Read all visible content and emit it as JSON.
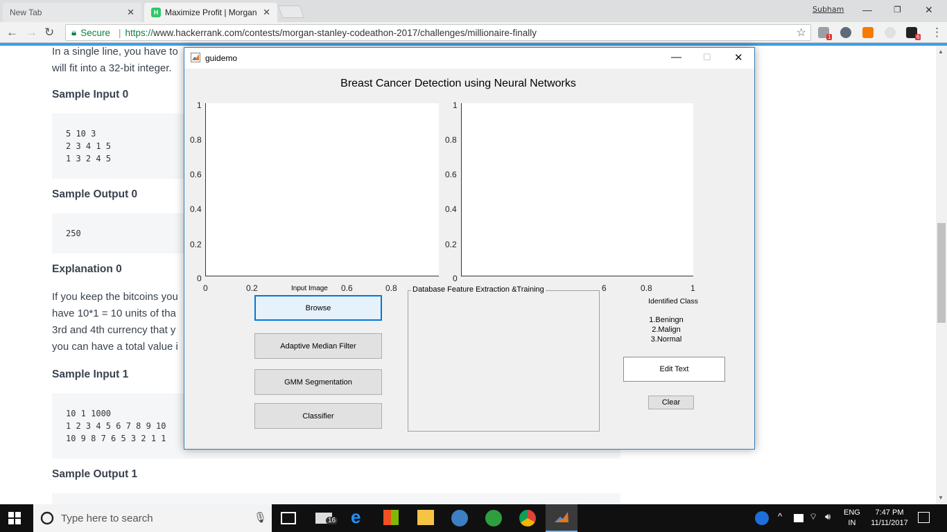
{
  "browser": {
    "tabs": [
      {
        "label": "New Tab"
      },
      {
        "label": "Maximize Profit | Morgan"
      }
    ],
    "user_name": "Subham",
    "secure_label": "Secure",
    "url_proto": "https://",
    "url_rest": "www.hackerrank.com/contests/morgan-stanley-codeathon-2017/challenges/millionaire-finally",
    "ext_badges": [
      "1",
      "6"
    ]
  },
  "page": {
    "intro_line1": "In a single line, you have to",
    "intro_line2": "will fit into a 32-bit integer.",
    "sample_input_0_heading": "Sample Input 0",
    "sample_input_0": [
      "5 10 3",
      "2 3 4 1 5",
      "1 3 2 4 5"
    ],
    "sample_output_0_heading": "Sample Output 0",
    "sample_output_0": "250",
    "explanation_heading": "Explanation 0",
    "explanation_lines": [
      "If you keep the bitcoins you",
      "have 10*1 = 10 units of tha",
      "3rd and 4th currency that y",
      "you can have a total value i"
    ],
    "sample_input_1_heading": "Sample Input 1",
    "sample_input_1": [
      "10 1 1000",
      "1 2 3 4 5 6 7 8 9 10",
      "10 9 8 7 6 5 3 2 1 1"
    ],
    "sample_output_1_heading": "Sample Output 1"
  },
  "guidemo": {
    "window_title": "guidemo",
    "heading": "Breast Cancer Detection using Neural Networks",
    "y_ticks": [
      "1",
      "0.8",
      "0.6",
      "0.4",
      "0.2",
      "0"
    ],
    "x_ticks_left": [
      "0",
      "0.2",
      "0.6",
      "0.8"
    ],
    "x_ticks_right": [
      "6",
      "0.8",
      "1"
    ],
    "input_image_label": "Input Image",
    "buttons": {
      "browse": "Browse",
      "median_filter": "Adaptive Median Filter",
      "gmm": "GMM Segmentation",
      "classifier": "Classifier",
      "clear": "Clear"
    },
    "panel_title": "Database Feature Extraction &Training",
    "identified_class_label": "Identified Class",
    "class_list": [
      "1.Beningn",
      "2.Malign",
      "3.Normal"
    ],
    "edit_text": "Edit Text"
  },
  "taskbar": {
    "search_placeholder": "Type here to search",
    "mail_badge": "16",
    "lang_line1": "ENG",
    "lang_line2": "IN",
    "time": "7:47 PM",
    "date": "11/11/2017"
  }
}
